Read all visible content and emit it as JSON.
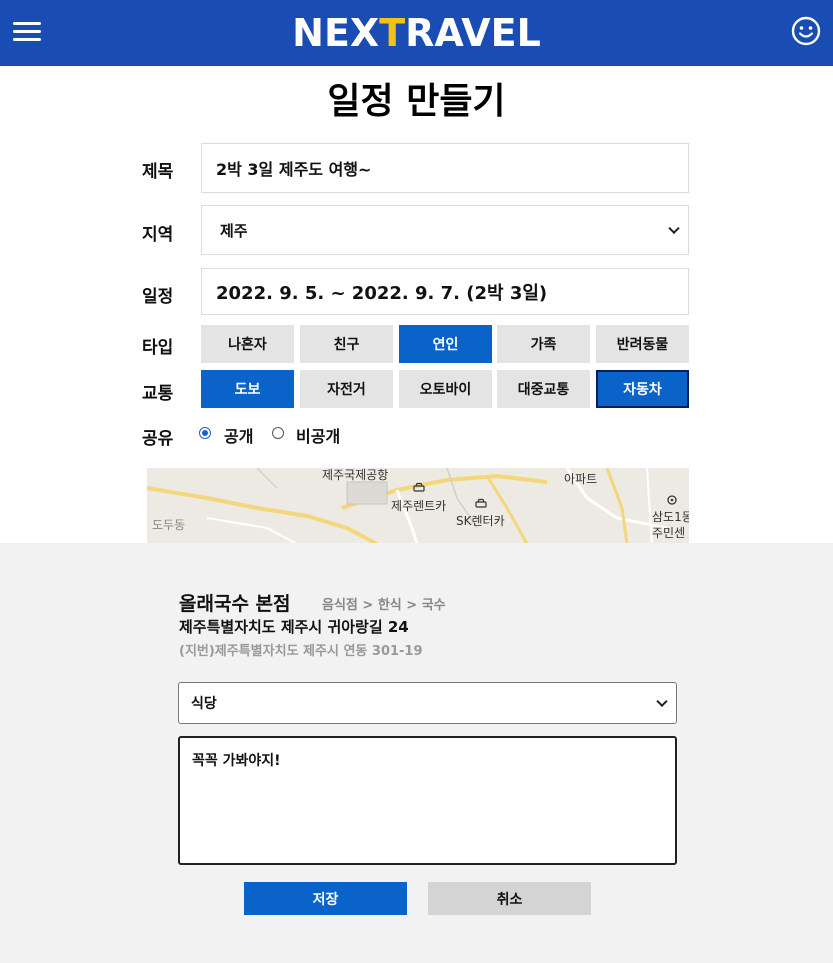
{
  "header": {
    "logo_part1": "NEX",
    "logo_accent": "T",
    "logo_part2": "RAVEL",
    "menu_icon": "hamburger-icon",
    "profile_icon": "smile-icon",
    "brand_color": "#1a4db3",
    "accent_color": "#f2c21b"
  },
  "page_title": "일정 만들기",
  "form": {
    "title_label": "제목",
    "title_value": "2박 3일 제주도 여행~",
    "region_label": "지역",
    "region_value": "제주",
    "date_label": "일정",
    "date_value": "2022. 9. 5. ~ 2022. 9. 7. (2박 3일)",
    "type_label": "타입",
    "type_options": [
      "나혼자",
      "친구",
      "연인",
      "가족",
      "반려동물"
    ],
    "type_selected": "연인",
    "transport_label": "교통",
    "transport_options": [
      "도보",
      "자전거",
      "오토바이",
      "대중교통",
      "자동차"
    ],
    "transport_selected": [
      "도보",
      "자동차"
    ],
    "share_label": "공유",
    "share_options": [
      "공개",
      "비공개"
    ],
    "share_selected": "공개"
  },
  "map": {
    "labels": [
      "제주국제공항",
      "아파트",
      "제주렌트카",
      "SK렌터카",
      "도두동",
      "삼도1동",
      "주민센"
    ]
  },
  "place": {
    "name": "올래국수 본점",
    "category": "음식점 > 한식 > 국수",
    "address": "제주특별자치도 제주시 귀아랑길 24",
    "jibun": "(지번)제주특별자치도 제주시 연동 301-19",
    "kind_value": "식당",
    "memo": "꼭꼭 가봐야지!"
  },
  "buttons": {
    "save": "저장",
    "cancel": "취소"
  },
  "colors": {
    "active_blue": "#0a63c9",
    "segment_gray": "#e4e4e4"
  }
}
